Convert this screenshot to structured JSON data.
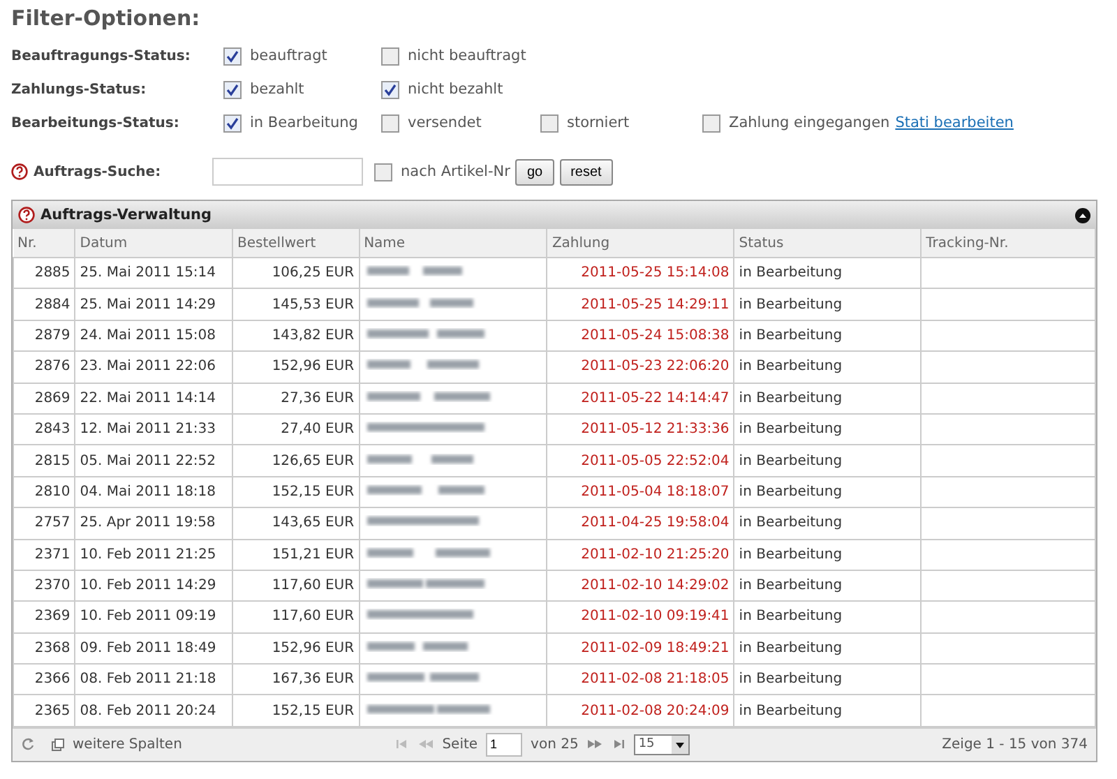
{
  "title": "Filter-Optionen:",
  "filters": [
    {
      "label": "Beauftragungs-Status:",
      "options": [
        {
          "label": "beauftragt",
          "checked": true
        },
        {
          "label": "nicht beauftragt",
          "checked": false
        }
      ]
    },
    {
      "label": "Zahlungs-Status:",
      "options": [
        {
          "label": "bezahlt",
          "checked": true
        },
        {
          "label": "nicht bezahlt",
          "checked": true
        }
      ]
    },
    {
      "label": "Bearbeitungs-Status:",
      "options": [
        {
          "label": "in Bearbeitung",
          "checked": true
        },
        {
          "label": "versendet",
          "checked": false
        },
        {
          "label": "storniert",
          "checked": false
        },
        {
          "label": "Zahlung eingegangen",
          "checked": false
        }
      ],
      "link": "Stati bearbeiten"
    }
  ],
  "search": {
    "label": "Auftrags-Suche:",
    "option": {
      "label": "nach Artikel-Nr",
      "checked": false
    },
    "buttons": [
      "go",
      "reset"
    ]
  },
  "panel": {
    "title": "Auftrags-Verwaltung",
    "columns": [
      "Nr.",
      "Datum",
      "Bestellwert",
      "Name",
      "Zahlung",
      "Status",
      "Tracking-Nr."
    ],
    "rows": [
      {
        "nr": "2885",
        "date": "25. Mai 2011 15:14",
        "value": "106,25 EUR",
        "payment": "2011-05-25 15:14:08",
        "status": "in Bearbeitung"
      },
      {
        "nr": "2884",
        "date": "25. Mai 2011 14:29",
        "value": "145,53 EUR",
        "payment": "2011-05-25 14:29:11",
        "status": "in Bearbeitung"
      },
      {
        "nr": "2879",
        "date": "24. Mai 2011 15:08",
        "value": "143,82 EUR",
        "payment": "2011-05-24 15:08:38",
        "status": "in Bearbeitung"
      },
      {
        "nr": "2876",
        "date": "23. Mai 2011 22:06",
        "value": "152,96 EUR",
        "payment": "2011-05-23 22:06:20",
        "status": "in Bearbeitung"
      },
      {
        "nr": "2869",
        "date": "22. Mai 2011 14:14",
        "value": "27,36 EUR",
        "payment": "2011-05-22 14:14:47",
        "status": "in Bearbeitung"
      },
      {
        "nr": "2843",
        "date": "12. Mai 2011 21:33",
        "value": "27,40 EUR",
        "payment": "2011-05-12 21:33:36",
        "status": "in Bearbeitung"
      },
      {
        "nr": "2815",
        "date": "05. Mai 2011 22:52",
        "value": "126,65 EUR",
        "payment": "2011-05-05 22:52:04",
        "status": "in Bearbeitung"
      },
      {
        "nr": "2810",
        "date": "04. Mai 2011 18:18",
        "value": "152,15 EUR",
        "payment": "2011-05-04 18:18:07",
        "status": "in Bearbeitung"
      },
      {
        "nr": "2757",
        "date": "25. Apr 2011 19:58",
        "value": "143,65 EUR",
        "payment": "2011-04-25 19:58:04",
        "status": "in Bearbeitung"
      },
      {
        "nr": "2371",
        "date": "10. Feb 2011 21:25",
        "value": "151,21 EUR",
        "payment": "2011-02-10 21:25:20",
        "status": "in Bearbeitung"
      },
      {
        "nr": "2370",
        "date": "10. Feb 2011 14:29",
        "value": "117,60 EUR",
        "payment": "2011-02-10 14:29:02",
        "status": "in Bearbeitung"
      },
      {
        "nr": "2369",
        "date": "10. Feb 2011 09:19",
        "value": "117,60 EUR",
        "payment": "2011-02-10 09:19:41",
        "status": "in Bearbeitung"
      },
      {
        "nr": "2368",
        "date": "09. Feb 2011 18:49",
        "value": "152,96 EUR",
        "payment": "2011-02-09 18:49:21",
        "status": "in Bearbeitung"
      },
      {
        "nr": "2366",
        "date": "08. Feb 2011 21:18",
        "value": "167,36 EUR",
        "payment": "2011-02-08 21:18:05",
        "status": "in Bearbeitung"
      },
      {
        "nr": "2365",
        "date": "08. Feb 2011 20:24",
        "value": "152,15 EUR",
        "payment": "2011-02-08 20:24:09",
        "status": "in Bearbeitung"
      }
    ],
    "footer": {
      "more_columns": "weitere Spalten",
      "page_label": "Seite",
      "page": "1",
      "page_total": "von 25",
      "page_size": "15",
      "summary": "Zeige 1 - 15 von 374"
    }
  }
}
